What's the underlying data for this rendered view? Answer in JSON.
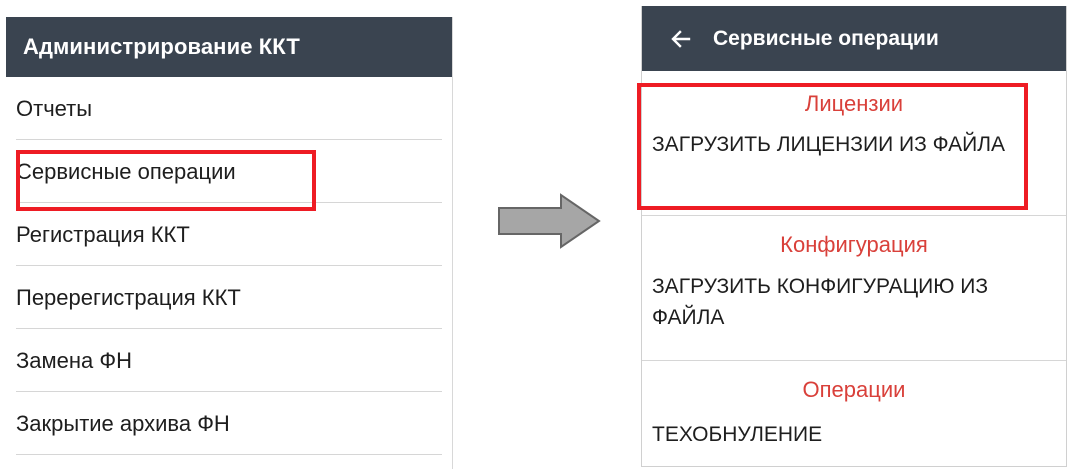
{
  "left_screen": {
    "appbar": {
      "title": "Администрирование ККТ"
    },
    "menu": [
      {
        "label": "Отчеты"
      },
      {
        "label": "Сервисные операции",
        "highlighted": true
      },
      {
        "label": "Регистрация ККТ"
      },
      {
        "label": "Перерегистрация ККТ"
      },
      {
        "label": "Замена ФН"
      },
      {
        "label": "Закрытие архива ФН"
      }
    ]
  },
  "transition_arrow": {
    "icon": "right-arrow-icon",
    "fill": "#a6a6a6",
    "stroke": "#666666"
  },
  "right_screen": {
    "appbar": {
      "back_icon": "back-arrow-icon",
      "title": "Сервисные операции"
    },
    "sections": [
      {
        "header": "Лицензии",
        "action": "ЗАГРУЗИТЬ ЛИЦЕНЗИИ ИЗ ФАЙЛА",
        "highlighted": true
      },
      {
        "header": "Конфигурация",
        "action": "ЗАГРУЗИТЬ КОНФИГУРАЦИЮ ИЗ ФАЙЛА"
      },
      {
        "header": "Операции",
        "action": "ТЕХОБНУЛЕНИЕ"
      }
    ]
  },
  "colors": {
    "appbar_bg": "#3a4450",
    "appbar_text": "#ffffff",
    "section_header": "#d9403a",
    "highlight": "#ee1c24",
    "divider": "#d6d6d6"
  }
}
